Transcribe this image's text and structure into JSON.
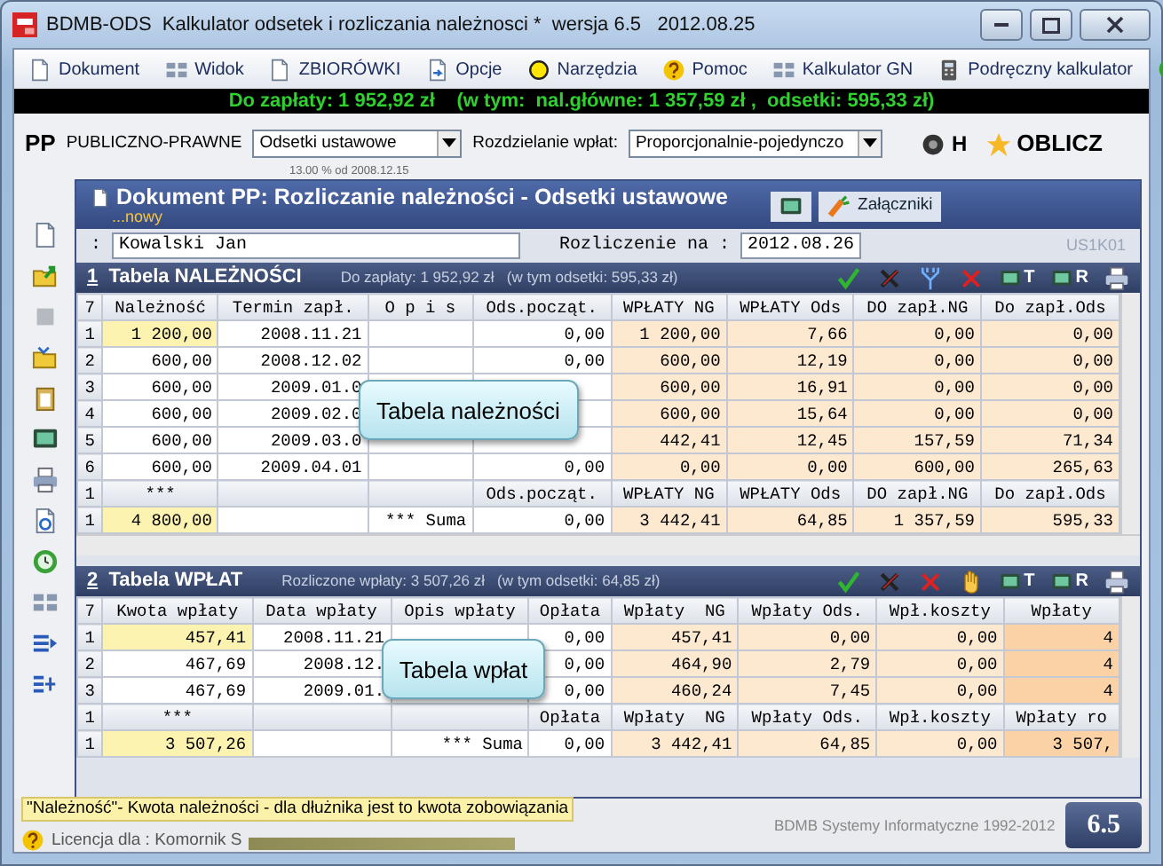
{
  "window": {
    "title": "BDMB-ODS  Kalkulator odsetek i rozliczania należnosci *  wersja 6.5   2012.08.25"
  },
  "menu": [
    {
      "label": "Dokument",
      "kind": "page"
    },
    {
      "label": "Widok",
      "kind": "grid"
    },
    {
      "label": "ZBIORÓWKI",
      "kind": "page"
    },
    {
      "label": "Opcje",
      "kind": "options"
    },
    {
      "label": "Narzędzia",
      "kind": "circle"
    },
    {
      "label": "Pomoc",
      "kind": "help"
    },
    {
      "label": "Kalkulator GN",
      "kind": "grid"
    },
    {
      "label": "Podręczny kalkulator",
      "kind": "calculator"
    },
    {
      "kind": "go"
    }
  ],
  "summary_bar": {
    "text": "Do zapłaty: 1 952,92 zł    (w tym:  nal.główne: 1 357,59 zł ,  odsetki: 595,33 zł)"
  },
  "toolbar": {
    "code": "PP",
    "category": "PUBLICZNO-PRAWNE",
    "interest_type": "Odsetki ustawowe",
    "interest_note": "13.00 % od 2008.12.15",
    "split_label": "Rozdzielanie wpłat:",
    "split": "Proporcjonalnie-pojedynczo",
    "h_label": "H",
    "calc_button": "OBLICZ"
  },
  "sidebar": [
    {
      "kind": "page"
    },
    {
      "kind": "folder-arrow"
    },
    {
      "kind": "square"
    },
    {
      "kind": "folder"
    },
    {
      "kind": "clipboard"
    },
    {
      "kind": "monitor"
    },
    {
      "kind": "printer"
    },
    {
      "kind": "doc-refresh"
    },
    {
      "kind": "clock"
    },
    {
      "kind": "grid"
    },
    {
      "kind": "lines-arrow"
    },
    {
      "kind": "lines-tree"
    }
  ],
  "document": {
    "title": "Dokument PP: Rozliczanie należności - Odsetki ustawowe",
    "subtitle": "...nowy",
    "attachments": "Załączniki",
    "debtor_label": ":",
    "debtor": "Kowalski Jan",
    "date_label": "Rozliczenie na :",
    "date": "2012.08.26",
    "code": "US1K01"
  },
  "tables": [
    {
      "number": "1",
      "title": "Tabela NALEŻNOŚCI",
      "summary": "Do zapłaty: 1 952,92 zł   (w tym odsetki: 595,33 zł)",
      "tools": [
        {
          "kind": "check"
        },
        {
          "kind": "cross-dark"
        },
        {
          "kind": "split"
        },
        {
          "kind": "cross"
        },
        {
          "kind": "view",
          "label": "T"
        },
        {
          "kind": "view",
          "label": "R"
        },
        {
          "kind": "print"
        }
      ],
      "row_count": "7",
      "columns": [
        {
          "label": "Należność",
          "color": "#ffffff"
        },
        {
          "label": "Termin zapł.",
          "color": "#ffffff"
        },
        {
          "label": "O p i s",
          "color": "#ffffff"
        },
        {
          "label": "Ods.począt.",
          "color": "#ffffff"
        },
        {
          "label": "WPŁATY NG",
          "color": "#fde8d0"
        },
        {
          "label": "WPŁATY Ods",
          "color": "#fde8d0"
        },
        {
          "label": "DO zapł.NG",
          "color": "#fde8d0"
        },
        {
          "label": "Do zapł.Ods",
          "color": "#fde8d0"
        }
      ],
      "rows": [
        {
          "no": "1",
          "selected": true,
          "cells": [
            {
              "text": "1 200,00"
            },
            {
              "text": "2008.11.21"
            },
            {
              "kind": "blank"
            },
            {
              "text": "0,00"
            },
            {
              "text": "1 200,00"
            },
            {
              "text": "7,66"
            },
            {
              "text": "0,00"
            },
            {
              "text": "0,00"
            }
          ]
        },
        {
          "no": "2",
          "selected": false,
          "cells": [
            {
              "text": "600,00"
            },
            {
              "text": "2008.12.02"
            },
            {
              "kind": "blank"
            },
            {
              "text": "0,00"
            },
            {
              "text": "600,00"
            },
            {
              "text": "12,19"
            },
            {
              "text": "0,00"
            },
            {
              "text": "0,00"
            }
          ]
        },
        {
          "no": "3",
          "selected": false,
          "callout": "Tabela należności",
          "cells": [
            {
              "text": "600,00"
            },
            {
              "text": "2009.01.0"
            },
            {
              "kind": "blank"
            },
            {
              "kind": "blank"
            },
            {
              "text": "600,00"
            },
            {
              "text": "16,91"
            },
            {
              "text": "0,00"
            },
            {
              "text": "0,00"
            }
          ]
        },
        {
          "no": "4",
          "selected": false,
          "cells": [
            {
              "text": "600,00"
            },
            {
              "text": "2009.02.0"
            },
            {
              "kind": "blank"
            },
            {
              "kind": "blank"
            },
            {
              "text": "600,00"
            },
            {
              "text": "15,64"
            },
            {
              "text": "0,00"
            },
            {
              "text": "0,00"
            }
          ]
        },
        {
          "no": "5",
          "selected": false,
          "cells": [
            {
              "text": "600,00"
            },
            {
              "text": "2009.03.0"
            },
            {
              "kind": "blank"
            },
            {
              "kind": "blank"
            },
            {
              "text": "442,41"
            },
            {
              "text": "12,45"
            },
            {
              "text": "157,59"
            },
            {
              "text": "71,34"
            }
          ]
        },
        {
          "no": "6",
          "selected": false,
          "cells": [
            {
              "text": "600,00"
            },
            {
              "text": "2009.04.01"
            },
            {
              "kind": "blank"
            },
            {
              "text": "0,00"
            },
            {
              "text": "0,00"
            },
            {
              "text": "0,00"
            },
            {
              "text": "600,00"
            },
            {
              "text": "265,63"
            }
          ]
        }
      ],
      "footer_header": {
        "no": "1",
        "cells": [
          {
            "text": "***"
          },
          {
            "kind": "blank"
          },
          {
            "kind": "blank"
          },
          {
            "text": "Ods.począt."
          },
          {
            "text": "WPŁATY NG"
          },
          {
            "text": "WPŁATY Ods"
          },
          {
            "text": "DO zapł.NG"
          },
          {
            "text": "Do zapł.Ods"
          }
        ]
      },
      "totals": {
        "no": "1",
        "cells": [
          {
            "text": "4 800,00"
          },
          {
            "kind": "blank"
          },
          {
            "text": "*** Suma"
          },
          {
            "text": "0,00"
          },
          {
            "text": "3 442,41"
          },
          {
            "text": "64,85"
          },
          {
            "text": "1 357,59"
          },
          {
            "text": "595,33"
          }
        ]
      }
    },
    {
      "number": "2",
      "title": "Tabela WPŁAT",
      "summary": "Rozliczone wpłaty: 3 507,26 zł   (w tym odsetki: 64,85 zł)",
      "tools": [
        {
          "kind": "check"
        },
        {
          "kind": "cross-dark"
        },
        {
          "kind": "cross"
        },
        {
          "kind": "hand"
        },
        {
          "kind": "view",
          "label": "T"
        },
        {
          "kind": "view",
          "label": "R"
        },
        {
          "kind": "print"
        }
      ],
      "row_count": "7",
      "columns": [
        {
          "label": "Kwota wpłaty",
          "color": "#ffffff"
        },
        {
          "label": "Data wpłaty",
          "color": "#ffffff"
        },
        {
          "label": "Opis wpłaty",
          "color": "#ffffff"
        },
        {
          "label": "Opłata",
          "color": "#ffffff"
        },
        {
          "label": "Wpłaty  NG",
          "color": "#fde8d0"
        },
        {
          "label": "Wpłaty Ods.",
          "color": "#fde8d0"
        },
        {
          "label": "Wpł.koszty",
          "color": "#fde8d0"
        },
        {
          "label": "Wpłaty",
          "color": "#fbd2a6"
        }
      ],
      "rows": [
        {
          "no": "1",
          "selected": true,
          "callout": "Tabela wpłat",
          "cells": [
            {
              "text": "457,41"
            },
            {
              "text": "2008.11.21"
            },
            {
              "kind": "blank"
            },
            {
              "text": "0,00"
            },
            {
              "text": "457,41"
            },
            {
              "text": "0,00"
            },
            {
              "text": "0,00"
            },
            {
              "text": "4"
            }
          ]
        },
        {
          "no": "2",
          "selected": false,
          "cells": [
            {
              "text": "467,69"
            },
            {
              "text": "2008.12."
            },
            {
              "kind": "blank"
            },
            {
              "text": "0,00"
            },
            {
              "text": "464,90"
            },
            {
              "text": "2,79"
            },
            {
              "text": "0,00"
            },
            {
              "text": "4"
            }
          ]
        },
        {
          "no": "3",
          "selected": false,
          "cells": [
            {
              "text": "467,69"
            },
            {
              "text": "2009.01."
            },
            {
              "kind": "blank"
            },
            {
              "text": "0,00"
            },
            {
              "text": "460,24"
            },
            {
              "text": "7,45"
            },
            {
              "text": "0,00"
            },
            {
              "text": "4"
            }
          ]
        }
      ],
      "footer_header": {
        "no": "1",
        "cells": [
          {
            "text": "***"
          },
          {
            "kind": "blank"
          },
          {
            "kind": "blank"
          },
          {
            "text": "Opłata"
          },
          {
            "text": "Wpłaty  NG"
          },
          {
            "text": "Wpłaty Ods."
          },
          {
            "text": "Wpł.koszty"
          },
          {
            "text": "Wpłaty ro"
          }
        ]
      },
      "totals": {
        "no": "1",
        "cells": [
          {
            "text": "3 507,26"
          },
          {
            "kind": "blank"
          },
          {
            "text": "*** Suma"
          },
          {
            "text": "0,00"
          },
          {
            "text": "3 442,41"
          },
          {
            "text": "64,85"
          },
          {
            "text": "0,00"
          },
          {
            "text": "3 507,"
          }
        ]
      }
    }
  ],
  "status": {
    "hint": "\"Należność\"- Kwota należności - dla dłużnika jest to kwota zobowiązania",
    "license": "Licencja dla : Komornik S",
    "copyright": "BDMB Systemy Informatyczne 1992-2012",
    "version": "6.5"
  }
}
